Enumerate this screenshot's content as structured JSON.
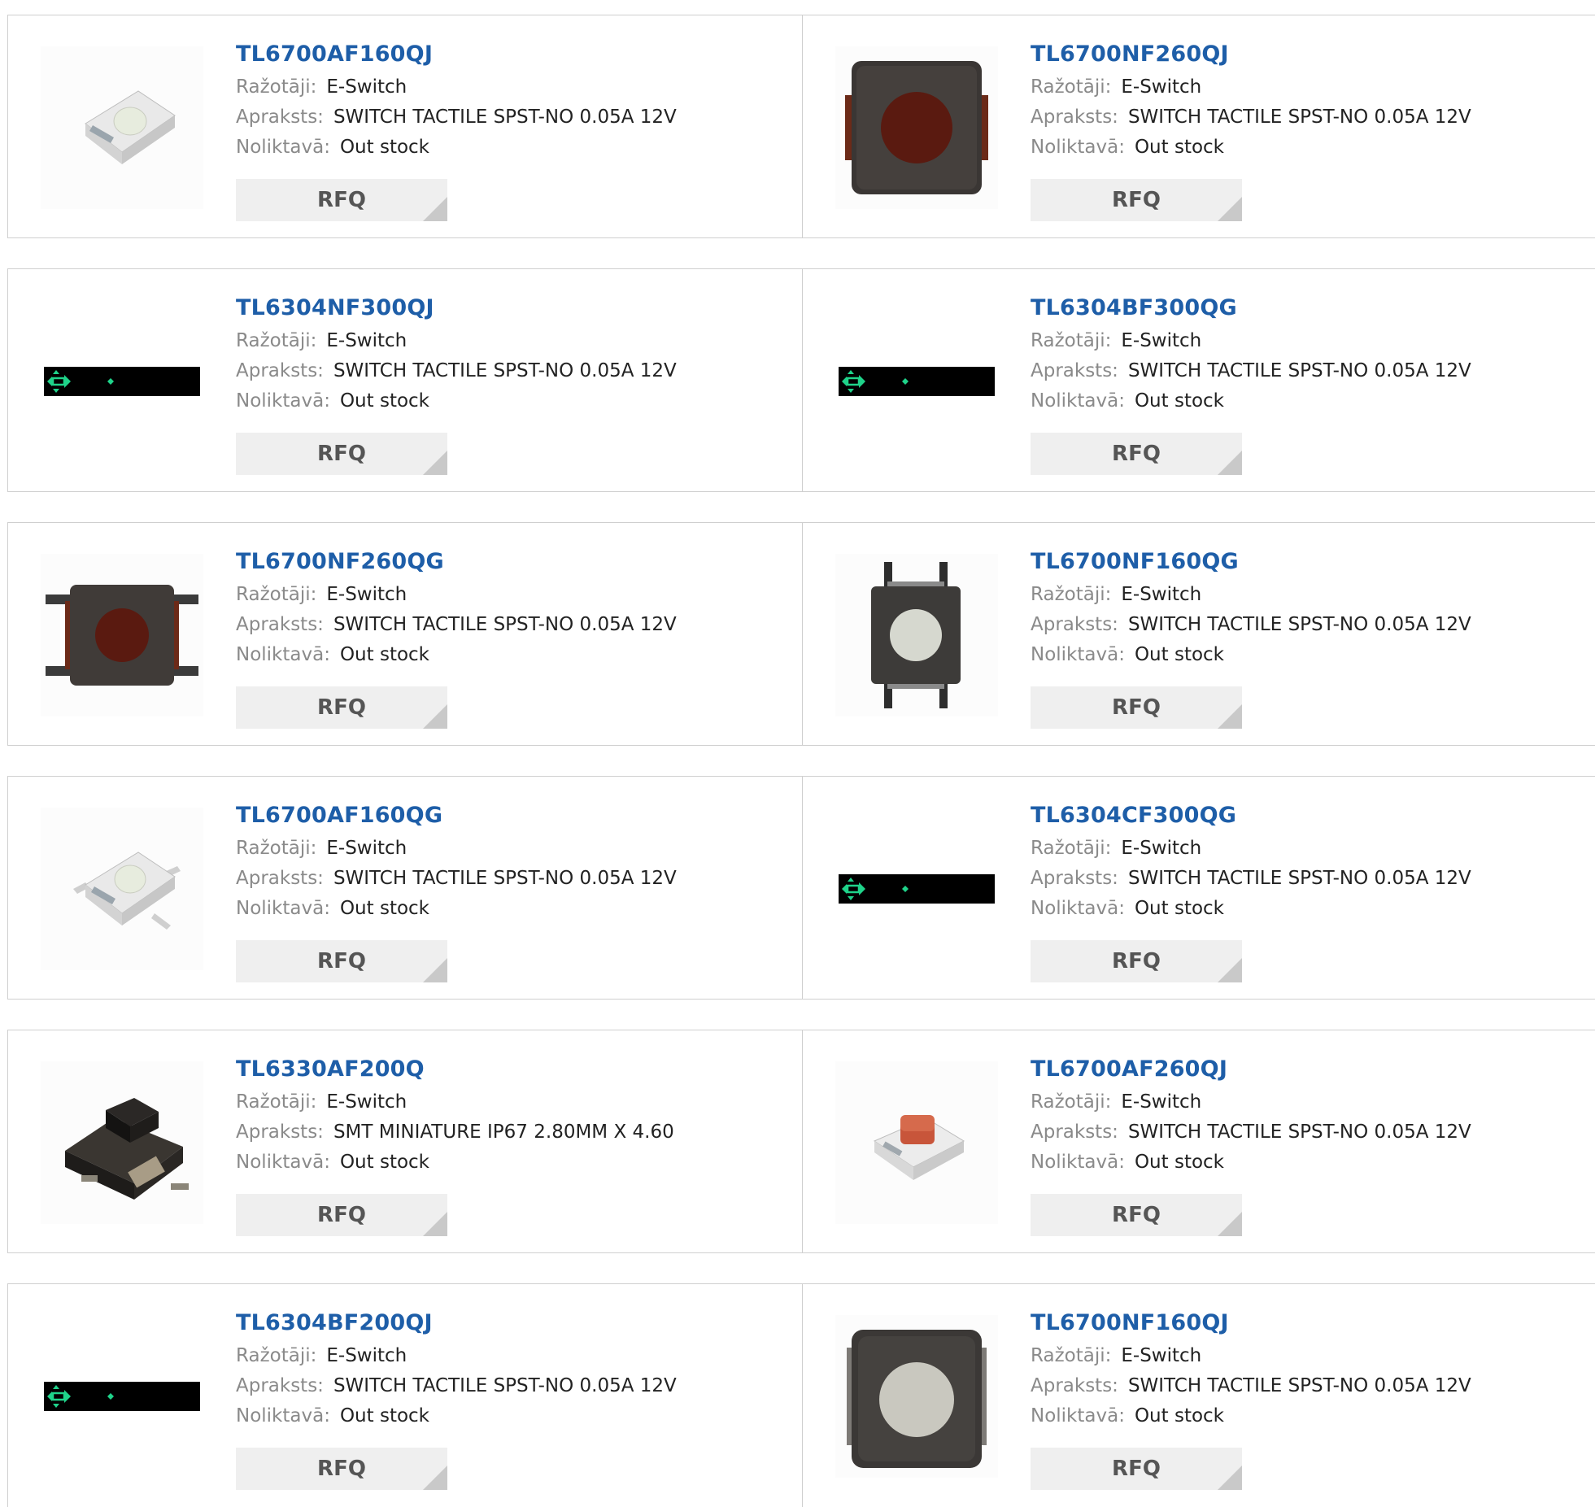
{
  "labels": {
    "manufacturer": "Ražotāji:",
    "description": "Apraksts:",
    "stock": "Noliktavā:",
    "rfq": "RFQ"
  },
  "products": [
    {
      "part": "TL6700AF160QJ",
      "manufacturer": "E-Switch",
      "description": "SWITCH TACTILE SPST-NO 0.05A 12V",
      "stock": "Out stock",
      "image": "white-smd-switch"
    },
    {
      "part": "TL6700NF260QJ",
      "manufacturer": "E-Switch",
      "description": "SWITCH TACTILE SPST-NO 0.05A 12V",
      "stock": "Out stock",
      "image": "dark-switch-red-button"
    },
    {
      "part": "TL6304NF300QJ",
      "manufacturer": "E-Switch",
      "description": "SWITCH TACTILE SPST-NO 0.05A 12V",
      "stock": "Out stock",
      "image": "no-image-placeholder"
    },
    {
      "part": "TL6304BF300QG",
      "manufacturer": "E-Switch",
      "description": "SWITCH TACTILE SPST-NO 0.05A 12V",
      "stock": "Out stock",
      "image": "no-image-placeholder"
    },
    {
      "part": "TL6700NF260QG",
      "manufacturer": "E-Switch",
      "description": "SWITCH TACTILE SPST-NO 0.05A 12V",
      "stock": "Out stock",
      "image": "dark-switch-red-button-leads"
    },
    {
      "part": "TL6700NF160QG",
      "manufacturer": "E-Switch",
      "description": "SWITCH TACTILE SPST-NO 0.05A 12V",
      "stock": "Out stock",
      "image": "dark-switch-white-button-leads"
    },
    {
      "part": "TL6700AF160QG",
      "manufacturer": "E-Switch",
      "description": "SWITCH TACTILE SPST-NO 0.05A 12V",
      "stock": "Out stock",
      "image": "white-smd-switch-leads"
    },
    {
      "part": "TL6304CF300QG",
      "manufacturer": "E-Switch",
      "description": "SWITCH TACTILE SPST-NO 0.05A 12V",
      "stock": "Out stock",
      "image": "no-image-placeholder"
    },
    {
      "part": "TL6330AF200Q",
      "manufacturer": "E-Switch",
      "description": "SMT MINIATURE IP67 2.80MM X 4.60",
      "stock": "Out stock",
      "image": "black-side-switch"
    },
    {
      "part": "TL6700AF260QJ",
      "manufacturer": "E-Switch",
      "description": "SWITCH TACTILE SPST-NO 0.05A 12V",
      "stock": "Out stock",
      "image": "white-smd-switch-red-button"
    },
    {
      "part": "TL6304BF200QJ",
      "manufacturer": "E-Switch",
      "description": "SWITCH TACTILE SPST-NO 0.05A 12V",
      "stock": "Out stock",
      "image": "no-image-placeholder"
    },
    {
      "part": "TL6700NF160QJ",
      "manufacturer": "E-Switch",
      "description": "SWITCH TACTILE SPST-NO 0.05A 12V",
      "stock": "Out stock",
      "image": "dark-switch-white-button"
    }
  ]
}
